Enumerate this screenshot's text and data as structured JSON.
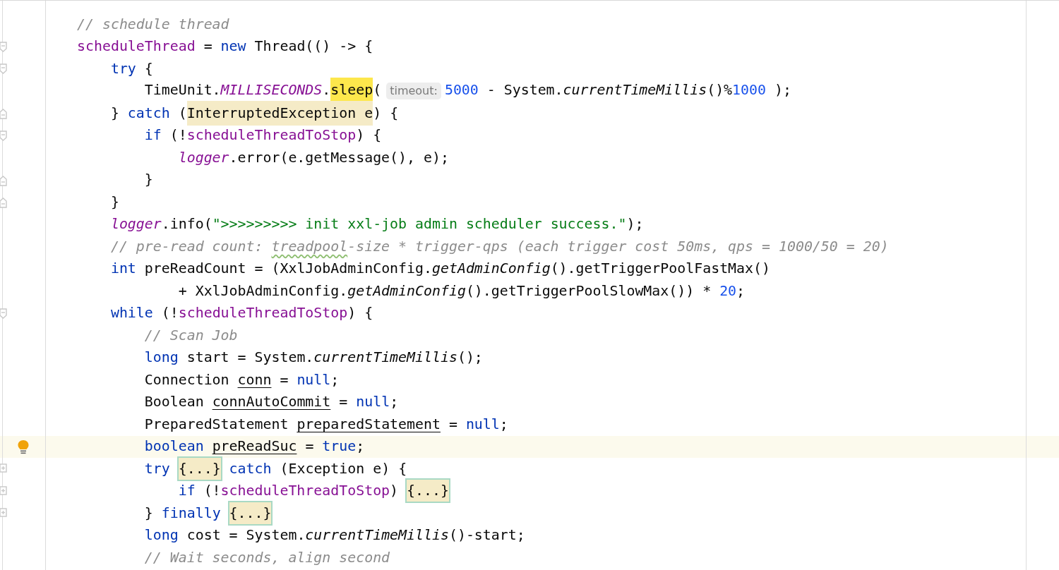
{
  "editor": {
    "lines": [
      {
        "current": false,
        "bulb": false,
        "fold_open": false,
        "fold_close": false,
        "collapsed": false,
        "tokens": [
          {
            "kind": "comment",
            "text": "// schedule thread"
          }
        ]
      },
      {
        "current": false,
        "bulb": false,
        "fold_open": true,
        "fold_close": false,
        "collapsed": false,
        "tokens": [
          {
            "kind": "field",
            "text": "scheduleThread"
          },
          {
            "kind": "plain",
            "text": " = "
          },
          {
            "kind": "keyword",
            "text": "new"
          },
          {
            "kind": "plain",
            "text": " Thread(() -> {"
          }
        ]
      },
      {
        "current": false,
        "bulb": false,
        "fold_open": true,
        "fold_close": false,
        "collapsed": false,
        "tokens": [
          {
            "kind": "keyword",
            "text": "    try"
          },
          {
            "kind": "plain",
            "text": " {"
          }
        ]
      },
      {
        "current": false,
        "bulb": false,
        "fold_open": false,
        "fold_close": false,
        "collapsed": false,
        "tokens": [
          {
            "kind": "plain",
            "text": "        TimeUnit."
          },
          {
            "kind": "static",
            "text": "MILLISECONDS"
          },
          {
            "kind": "plain",
            "text": "."
          },
          {
            "kind": "match",
            "text": "sleep"
          },
          {
            "kind": "plain",
            "text": "("
          },
          {
            "kind": "hint",
            "text": "timeout:"
          },
          {
            "kind": "number",
            "text": "5000"
          },
          {
            "kind": "plain",
            "text": " - System."
          },
          {
            "kind": "call",
            "text": "currentTimeMillis"
          },
          {
            "kind": "plain",
            "text": "()%"
          },
          {
            "kind": "number",
            "text": "1000"
          },
          {
            "kind": "plain",
            "text": " );"
          }
        ]
      },
      {
        "current": false,
        "bulb": false,
        "fold_open": false,
        "fold_close": true,
        "collapsed": false,
        "tokens": [
          {
            "kind": "plain",
            "text": "    } "
          },
          {
            "kind": "keyword",
            "text": "catch"
          },
          {
            "kind": "plain",
            "text": " ("
          },
          {
            "kind": "usage",
            "text": "InterruptedException e"
          },
          {
            "kind": "plain",
            "text": ") {"
          }
        ]
      },
      {
        "current": false,
        "bulb": false,
        "fold_open": true,
        "fold_close": false,
        "collapsed": false,
        "tokens": [
          {
            "kind": "keyword",
            "text": "        if"
          },
          {
            "kind": "plain",
            "text": " (!"
          },
          {
            "kind": "field",
            "text": "scheduleThreadToStop"
          },
          {
            "kind": "plain",
            "text": ") {"
          }
        ]
      },
      {
        "current": false,
        "bulb": false,
        "fold_open": false,
        "fold_close": false,
        "collapsed": false,
        "tokens": [
          {
            "kind": "static",
            "text": "            logger"
          },
          {
            "kind": "plain",
            "text": ".error(e.getMessage(), e);"
          }
        ]
      },
      {
        "current": false,
        "bulb": false,
        "fold_open": false,
        "fold_close": true,
        "collapsed": false,
        "tokens": [
          {
            "kind": "plain",
            "text": "        }"
          }
        ]
      },
      {
        "current": false,
        "bulb": false,
        "fold_open": false,
        "fold_close": true,
        "collapsed": false,
        "tokens": [
          {
            "kind": "plain",
            "text": "    }"
          }
        ]
      },
      {
        "current": false,
        "bulb": false,
        "fold_open": false,
        "fold_close": false,
        "collapsed": false,
        "tokens": [
          {
            "kind": "static",
            "text": "    logger"
          },
          {
            "kind": "plain",
            "text": ".info("
          },
          {
            "kind": "string",
            "text": "\">>>>>>>>> init xxl-job admin scheduler success.\""
          },
          {
            "kind": "plain",
            "text": ");"
          }
        ]
      },
      {
        "current": false,
        "bulb": false,
        "fold_open": false,
        "fold_close": false,
        "collapsed": false,
        "tokens": [
          {
            "kind": "comment",
            "text": "    // pre-read count: "
          },
          {
            "kind": "typo",
            "text": "treadpool"
          },
          {
            "kind": "comment",
            "text": "-size * trigger-qps (each trigger cost 50ms, qps = 1000/50 = 20)"
          }
        ]
      },
      {
        "current": false,
        "bulb": false,
        "fold_open": false,
        "fold_close": false,
        "collapsed": false,
        "tokens": [
          {
            "kind": "keyword",
            "text": "    int"
          },
          {
            "kind": "plain",
            "text": " preReadCount = (XxlJobAdminConfig."
          },
          {
            "kind": "call",
            "text": "getAdminConfig"
          },
          {
            "kind": "plain",
            "text": "().getTriggerPoolFastMax()"
          }
        ]
      },
      {
        "current": false,
        "bulb": false,
        "fold_open": false,
        "fold_close": false,
        "collapsed": false,
        "tokens": [
          {
            "kind": "plain",
            "text": "            + XxlJobAdminConfig."
          },
          {
            "kind": "call",
            "text": "getAdminConfig"
          },
          {
            "kind": "plain",
            "text": "().getTriggerPoolSlowMax()) * "
          },
          {
            "kind": "number",
            "text": "20"
          },
          {
            "kind": "plain",
            "text": ";"
          }
        ]
      },
      {
        "current": false,
        "bulb": false,
        "fold_open": true,
        "fold_close": false,
        "collapsed": false,
        "tokens": [
          {
            "kind": "keyword",
            "text": "    while"
          },
          {
            "kind": "plain",
            "text": " (!"
          },
          {
            "kind": "field",
            "text": "scheduleThreadToStop"
          },
          {
            "kind": "plain",
            "text": ") {"
          }
        ]
      },
      {
        "current": false,
        "bulb": false,
        "fold_open": false,
        "fold_close": false,
        "collapsed": false,
        "tokens": [
          {
            "kind": "comment",
            "text": "        // Scan Job"
          }
        ]
      },
      {
        "current": false,
        "bulb": false,
        "fold_open": false,
        "fold_close": false,
        "collapsed": false,
        "tokens": [
          {
            "kind": "keyword",
            "text": "        long"
          },
          {
            "kind": "plain",
            "text": " start = System."
          },
          {
            "kind": "call",
            "text": "currentTimeMillis"
          },
          {
            "kind": "plain",
            "text": "();"
          }
        ]
      },
      {
        "current": false,
        "bulb": false,
        "fold_open": false,
        "fold_close": false,
        "collapsed": false,
        "tokens": [
          {
            "kind": "plain",
            "text": "        Connection "
          },
          {
            "kind": "reassigned",
            "text": "conn"
          },
          {
            "kind": "plain",
            "text": " = "
          },
          {
            "kind": "keyword",
            "text": "null"
          },
          {
            "kind": "plain",
            "text": ";"
          }
        ]
      },
      {
        "current": false,
        "bulb": false,
        "fold_open": false,
        "fold_close": false,
        "collapsed": false,
        "tokens": [
          {
            "kind": "plain",
            "text": "        Boolean "
          },
          {
            "kind": "reassigned",
            "text": "connAutoCommit"
          },
          {
            "kind": "plain",
            "text": " = "
          },
          {
            "kind": "keyword",
            "text": "null"
          },
          {
            "kind": "plain",
            "text": ";"
          }
        ]
      },
      {
        "current": false,
        "bulb": false,
        "fold_open": false,
        "fold_close": false,
        "collapsed": false,
        "tokens": [
          {
            "kind": "plain",
            "text": "        PreparedStatement "
          },
          {
            "kind": "reassigned",
            "text": "preparedStatement"
          },
          {
            "kind": "plain",
            "text": " = "
          },
          {
            "kind": "keyword",
            "text": "null"
          },
          {
            "kind": "plain",
            "text": ";"
          }
        ]
      },
      {
        "current": true,
        "bulb": true,
        "fold_open": false,
        "fold_close": false,
        "collapsed": false,
        "tokens": [
          {
            "kind": "keyword",
            "text": "        boolean"
          },
          {
            "kind": "reassigned",
            "text": " preReadSuc"
          },
          {
            "kind": "plain",
            "text": " = "
          },
          {
            "kind": "keyword",
            "text": "true"
          },
          {
            "kind": "plain",
            "text": ";"
          }
        ]
      },
      {
        "current": false,
        "bulb": false,
        "fold_open": false,
        "fold_close": false,
        "collapsed": true,
        "tokens": [
          {
            "kind": "keyword",
            "text": "        try"
          },
          {
            "kind": "folded",
            "text": " {...}"
          },
          {
            "kind": "keyword",
            "text": " catch"
          },
          {
            "kind": "plain",
            "text": " (Exception e) {"
          }
        ]
      },
      {
        "current": false,
        "bulb": false,
        "fold_open": false,
        "fold_close": false,
        "collapsed": true,
        "tokens": [
          {
            "kind": "keyword",
            "text": "            if"
          },
          {
            "kind": "plain",
            "text": " (!"
          },
          {
            "kind": "field",
            "text": "scheduleThreadToStop"
          },
          {
            "kind": "plain",
            "text": ")"
          },
          {
            "kind": "folded",
            "text": " {...}"
          }
        ]
      },
      {
        "current": false,
        "bulb": false,
        "fold_open": false,
        "fold_close": false,
        "collapsed": true,
        "tokens": [
          {
            "kind": "plain",
            "text": "        }"
          },
          {
            "kind": "keyword",
            "text": " finally"
          },
          {
            "kind": "folded",
            "text": " {...}"
          }
        ]
      },
      {
        "current": false,
        "bulb": false,
        "fold_open": false,
        "fold_close": false,
        "collapsed": false,
        "tokens": [
          {
            "kind": "keyword",
            "text": "        long"
          },
          {
            "kind": "plain",
            "text": " cost = System."
          },
          {
            "kind": "call",
            "text": "currentTimeMillis"
          },
          {
            "kind": "plain",
            "text": "()-start;"
          }
        ]
      },
      {
        "current": false,
        "bulb": false,
        "fold_open": false,
        "fold_close": false,
        "collapsed": false,
        "tokens": [
          {
            "kind": "comment",
            "text": "        // Wait seconds, align second"
          }
        ]
      }
    ]
  }
}
